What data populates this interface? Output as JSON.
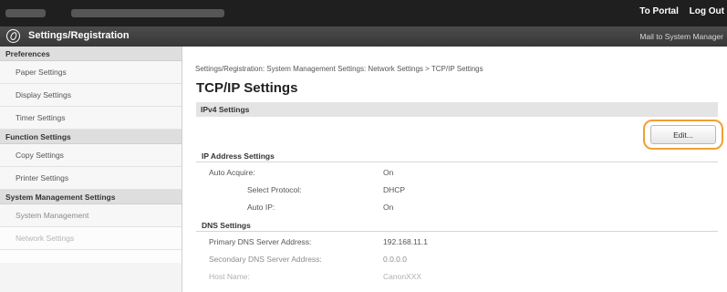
{
  "topbar": {
    "portal_link": "To Portal",
    "logout_link": "Log Out"
  },
  "titlebar": {
    "app_title": "Settings/Registration",
    "icon": "settings-registration-icon",
    "mail_link": "Mail to System Manager"
  },
  "sidebar": {
    "sections": [
      {
        "header": "Preferences",
        "items": [
          "Paper Settings",
          "Display Settings",
          "Timer Settings"
        ]
      },
      {
        "header": "Function Settings",
        "items": [
          "Copy Settings",
          "Printer Settings"
        ]
      },
      {
        "header": "System Management Settings",
        "items": [
          "System Management",
          "Network Settings"
        ]
      }
    ]
  },
  "main": {
    "breadcrumb": "Settings/Registration: System Management Settings: Network Settings > TCP/IP Settings",
    "title": "TCP/IP Settings",
    "ipv4_header": "IPv4 Settings",
    "edit_label": "Edit...",
    "ip_section": {
      "header": "IP Address Settings",
      "rows": [
        {
          "label": "Auto Acquire:",
          "value": "On"
        },
        {
          "label": "Select Protocol:",
          "value": "DHCP"
        },
        {
          "label": "Auto IP:",
          "value": "On"
        }
      ]
    },
    "dns_section": {
      "header": "DNS Settings",
      "rows": [
        {
          "label": "Primary DNS Server Address:",
          "value": "192.168.11.1"
        },
        {
          "label": "Secondary DNS Server Address:",
          "value": "0.0.0.0"
        },
        {
          "label": "Host Name:",
          "value": "CanonXXX"
        }
      ]
    }
  },
  "colors": {
    "topbar_bg": "#1f1f1f",
    "titlebar_bg": "#3f3f3f",
    "highlight_ring": "#f0a030",
    "section_bar": "#e4e4e4"
  }
}
